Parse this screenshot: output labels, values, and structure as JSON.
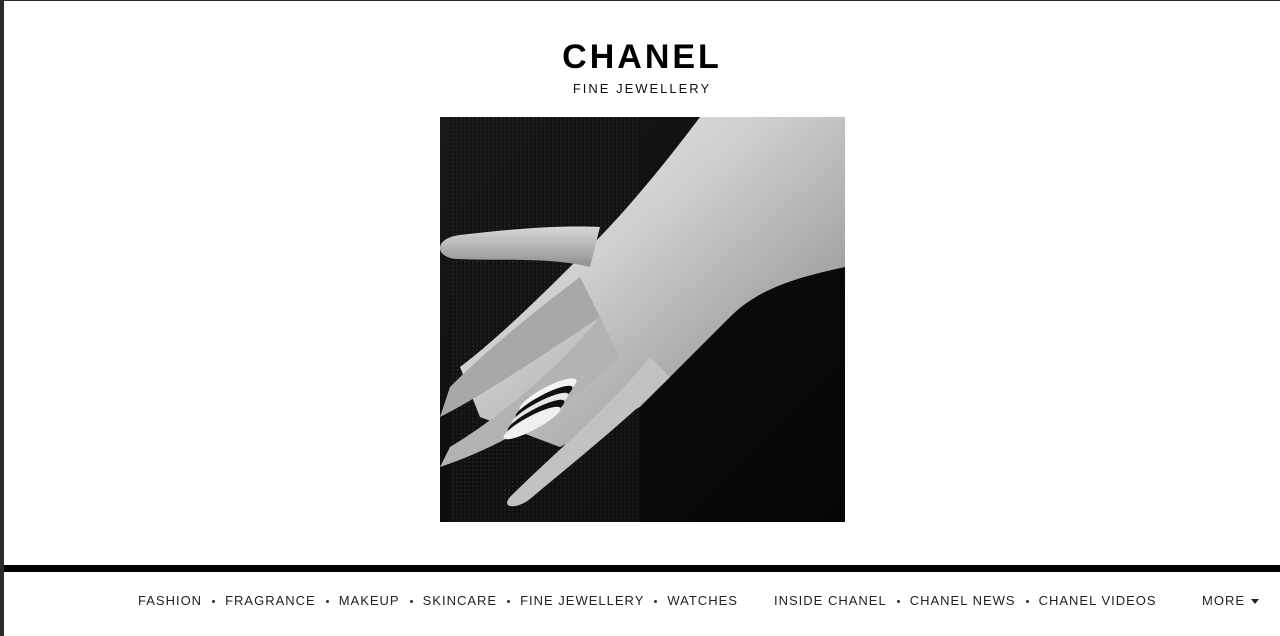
{
  "brand": {
    "wordmark": "CHANEL",
    "subtitle": "FINE JEWELLERY"
  },
  "hero": {
    "icon": "hand-with-rings-photo"
  },
  "nav": {
    "primary": [
      {
        "label": "FASHION"
      },
      {
        "label": "FRAGRANCE"
      },
      {
        "label": "MAKEUP"
      },
      {
        "label": "SKINCARE"
      },
      {
        "label": "FINE JEWELLERY"
      },
      {
        "label": "WATCHES"
      }
    ],
    "secondary": [
      {
        "label": "INSIDE CHANEL"
      },
      {
        "label": "CHANEL NEWS"
      },
      {
        "label": "CHANEL VIDEOS"
      }
    ],
    "more_label": "MORE"
  },
  "colors": {
    "background": "#ffffff",
    "text": "#000000",
    "bar": "#000000"
  }
}
